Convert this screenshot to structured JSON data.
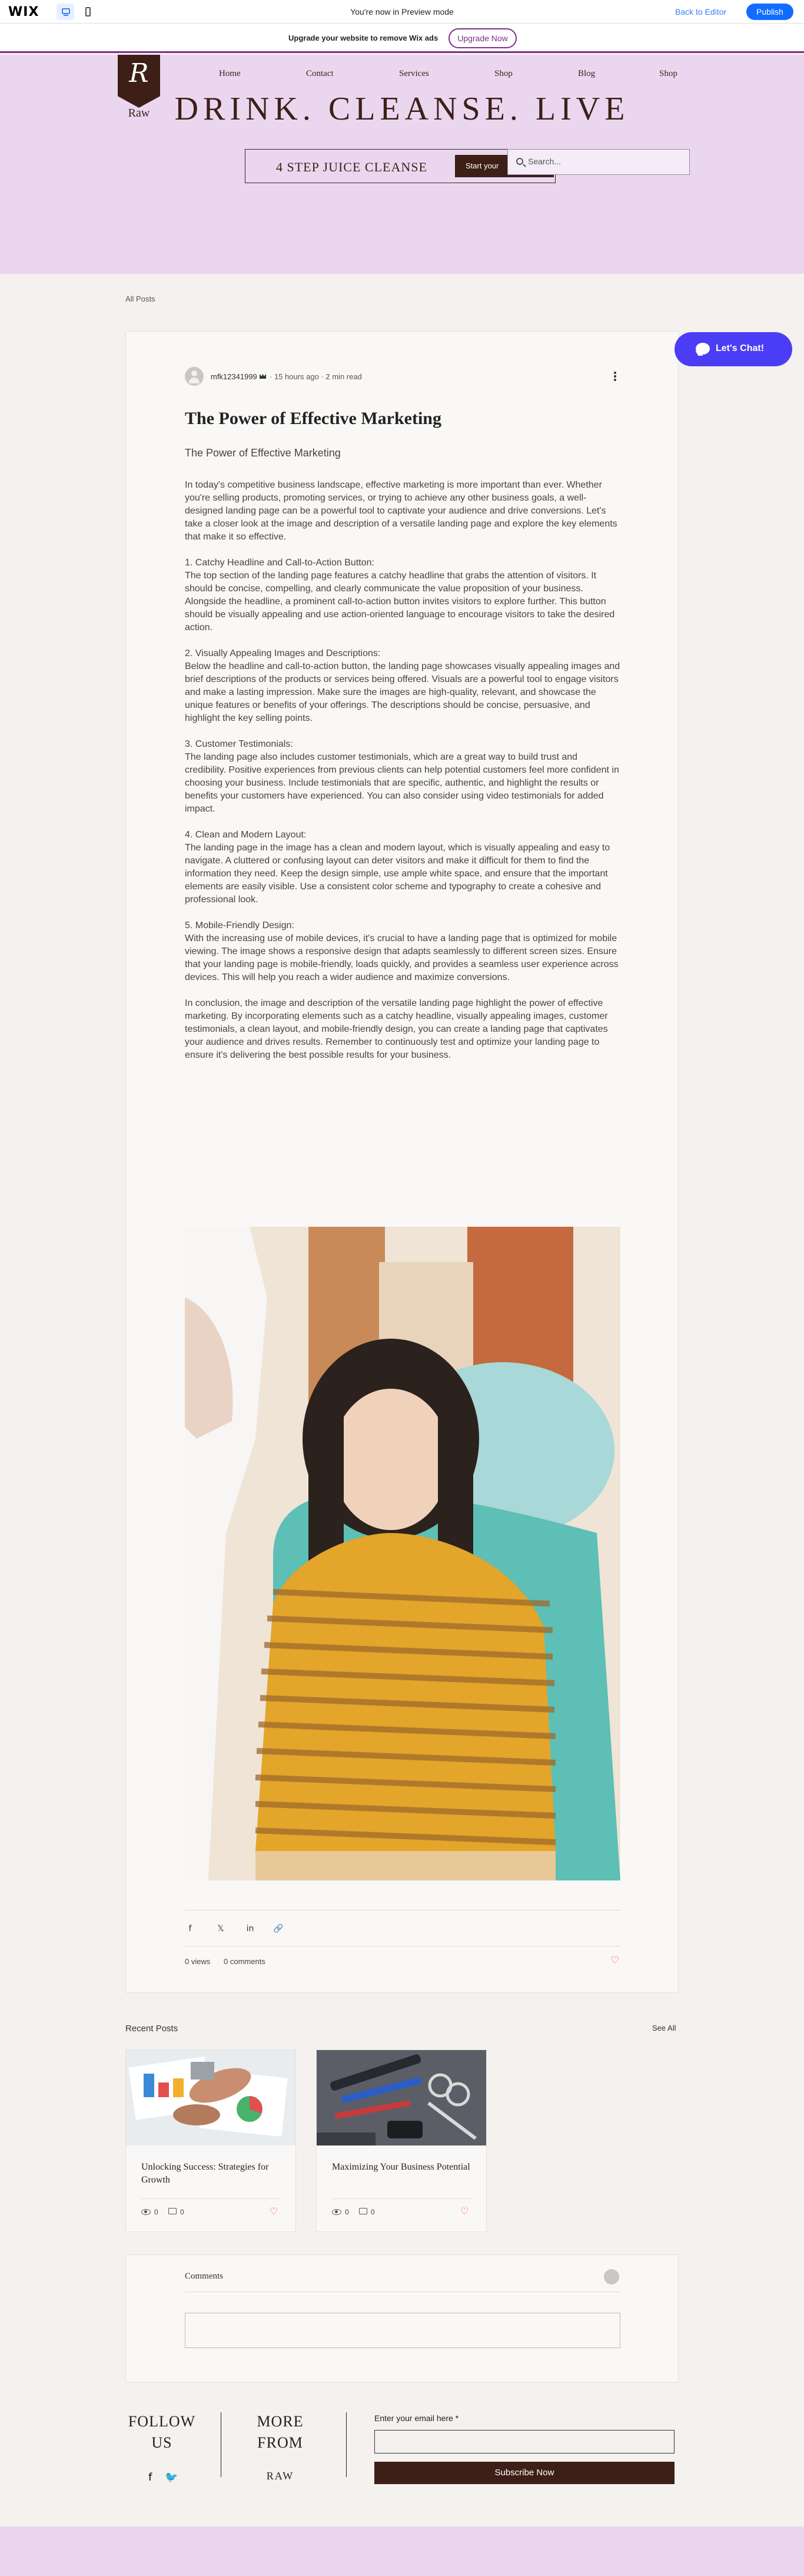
{
  "wix_bar": {
    "logo": "WIX",
    "preview_text": "You're now in Preview mode",
    "back_to_editor": "Back to Editor",
    "publish": "Publish"
  },
  "upgrade_bar": {
    "text": "Upgrade your website to remove Wix ads",
    "button": "Upgrade Now"
  },
  "header": {
    "logo_glyph": "R",
    "logo_word": "Raw",
    "nav": [
      "Home",
      "Contact",
      "Services",
      "Shop",
      "Blog",
      "Shop"
    ],
    "headline": "DRINK. CLEANSE. LIVE",
    "banner_text": "4 STEP JUICE CLEANSE",
    "banner_button": "Start your",
    "search_placeholder": "Search..."
  },
  "breadcrumb": "All Posts",
  "chat": {
    "label": "Let's Chat!"
  },
  "post": {
    "author": "mfk12341999",
    "meta": "· 15 hours ago · 2 min read",
    "title": "The Power of Effective Marketing",
    "subtitle": "The Power of Effective Marketing",
    "paragraphs": [
      "In today's competitive business landscape, effective marketing is more important than ever. Whether you're selling products, promoting services, or trying to achieve any other business goals, a well-designed landing page can be a powerful tool to captivate your audience and drive conversions. Let's take a closer look at the image and description of a versatile landing page and explore the key elements that make it so effective.",
      "1. Catchy Headline and Call-to-Action Button:\nThe top section of the landing page features a catchy headline that grabs the attention of visitors. It should be concise, compelling, and clearly communicate the value proposition of your business. Alongside the headline, a prominent call-to-action button invites visitors to explore further. This button should be visually appealing and use action-oriented language to encourage visitors to take the desired action.",
      "2. Visually Appealing Images and Descriptions:\nBelow the headline and call-to-action button, the landing page showcases visually appealing images and brief descriptions of the products or services being offered. Visuals are a powerful tool to engage visitors and make a lasting impression. Make sure the images are high-quality, relevant, and showcase the unique features or benefits of your offerings. The descriptions should be concise, persuasive, and highlight the key selling points.",
      "3. Customer Testimonials:\nThe landing page also includes customer testimonials, which are a great way to build trust and credibility. Positive experiences from previous clients can help potential customers feel more confident in choosing your business. Include testimonials that are specific, authentic, and highlight the results or benefits your customers have experienced. You can also consider using video testimonials for added impact.",
      "4. Clean and Modern Layout:\nThe landing page in the image has a clean and modern layout, which is visually appealing and easy to navigate. A cluttered or confusing layout can deter visitors and make it difficult for them to find the information they need. Keep the design simple, use ample white space, and ensure that the important elements are easily visible. Use a consistent color scheme and typography to create a cohesive and professional look.",
      "5. Mobile-Friendly Design:\nWith the increasing use of mobile devices, it's crucial to have a landing page that is optimized for mobile viewing. The image shows a responsive design that adapts seamlessly to different screen sizes. Ensure that your landing page is mobile-friendly, loads quickly, and provides a seamless user experience across devices. This will help you reach a wider audience and maximize conversions.",
      "In conclusion, the image and description of the versatile landing page highlight the power of effective marketing. By incorporating elements such as a catchy headline, visually appealing images, customer testimonials, a clean layout, and mobile-friendly design, you can create a landing page that captivates your audience and drives results. Remember to continuously test and optimize your landing page to ensure it's delivering the best possible results for your business."
    ],
    "views": "0 views",
    "comments": "0 comments",
    "share_icons": [
      "facebook-icon",
      "x-icon",
      "linkedin-icon",
      "link-icon"
    ]
  },
  "recent": {
    "title": "Recent Posts",
    "see_all": "See All",
    "cards": [
      {
        "title": "Unlocking Success: Strategies for Growth",
        "views": "0",
        "comments": "0"
      },
      {
        "title": "Maximizing Your Business Potential",
        "views": "0",
        "comments": "0"
      }
    ]
  },
  "comments": {
    "title": "Comments"
  },
  "footer": {
    "follow": "FOLLOW US",
    "more": "MORE FROM",
    "raw": "RAW",
    "email_label": "Enter your email here *",
    "subscribe": "Subscribe Now"
  },
  "colors": {
    "brand_dark": "#3d1f17",
    "header_bg": "#ead7ef",
    "page_bg": "#f5f1ee",
    "chat_blue": "#4b3df5",
    "wix_blue": "#116dff",
    "upgrade_purple": "#7e2f8a"
  }
}
